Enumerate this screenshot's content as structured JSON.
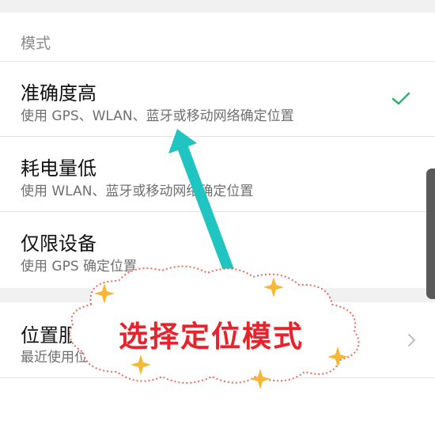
{
  "section": {
    "header": "模式"
  },
  "options": [
    {
      "title": "准确度高",
      "desc": "使用 GPS、WLAN、蓝牙或移动网络确定位置",
      "selected": true
    },
    {
      "title": "耗电量低",
      "desc": "使用 WLAN、蓝牙或移动网络确定位置",
      "selected": false
    },
    {
      "title": "仅限设备",
      "desc": "使用 GPS 确定位置",
      "selected": false
    }
  ],
  "location_service": {
    "title": "位置服务",
    "desc": "最近使用位置"
  },
  "annotation": {
    "callout": "选择定位模式"
  },
  "colors": {
    "check": "#2db46a",
    "arrow": "#20c4c0",
    "callout_text": "#e8232b",
    "sparkle": "#f5b835",
    "cloud_border": "#ef6a55"
  },
  "icons": {
    "check": "check-icon",
    "chevron": "chevron-right-icon",
    "arrow": "pointer-arrow",
    "sparkle": "sparkle-icon"
  }
}
